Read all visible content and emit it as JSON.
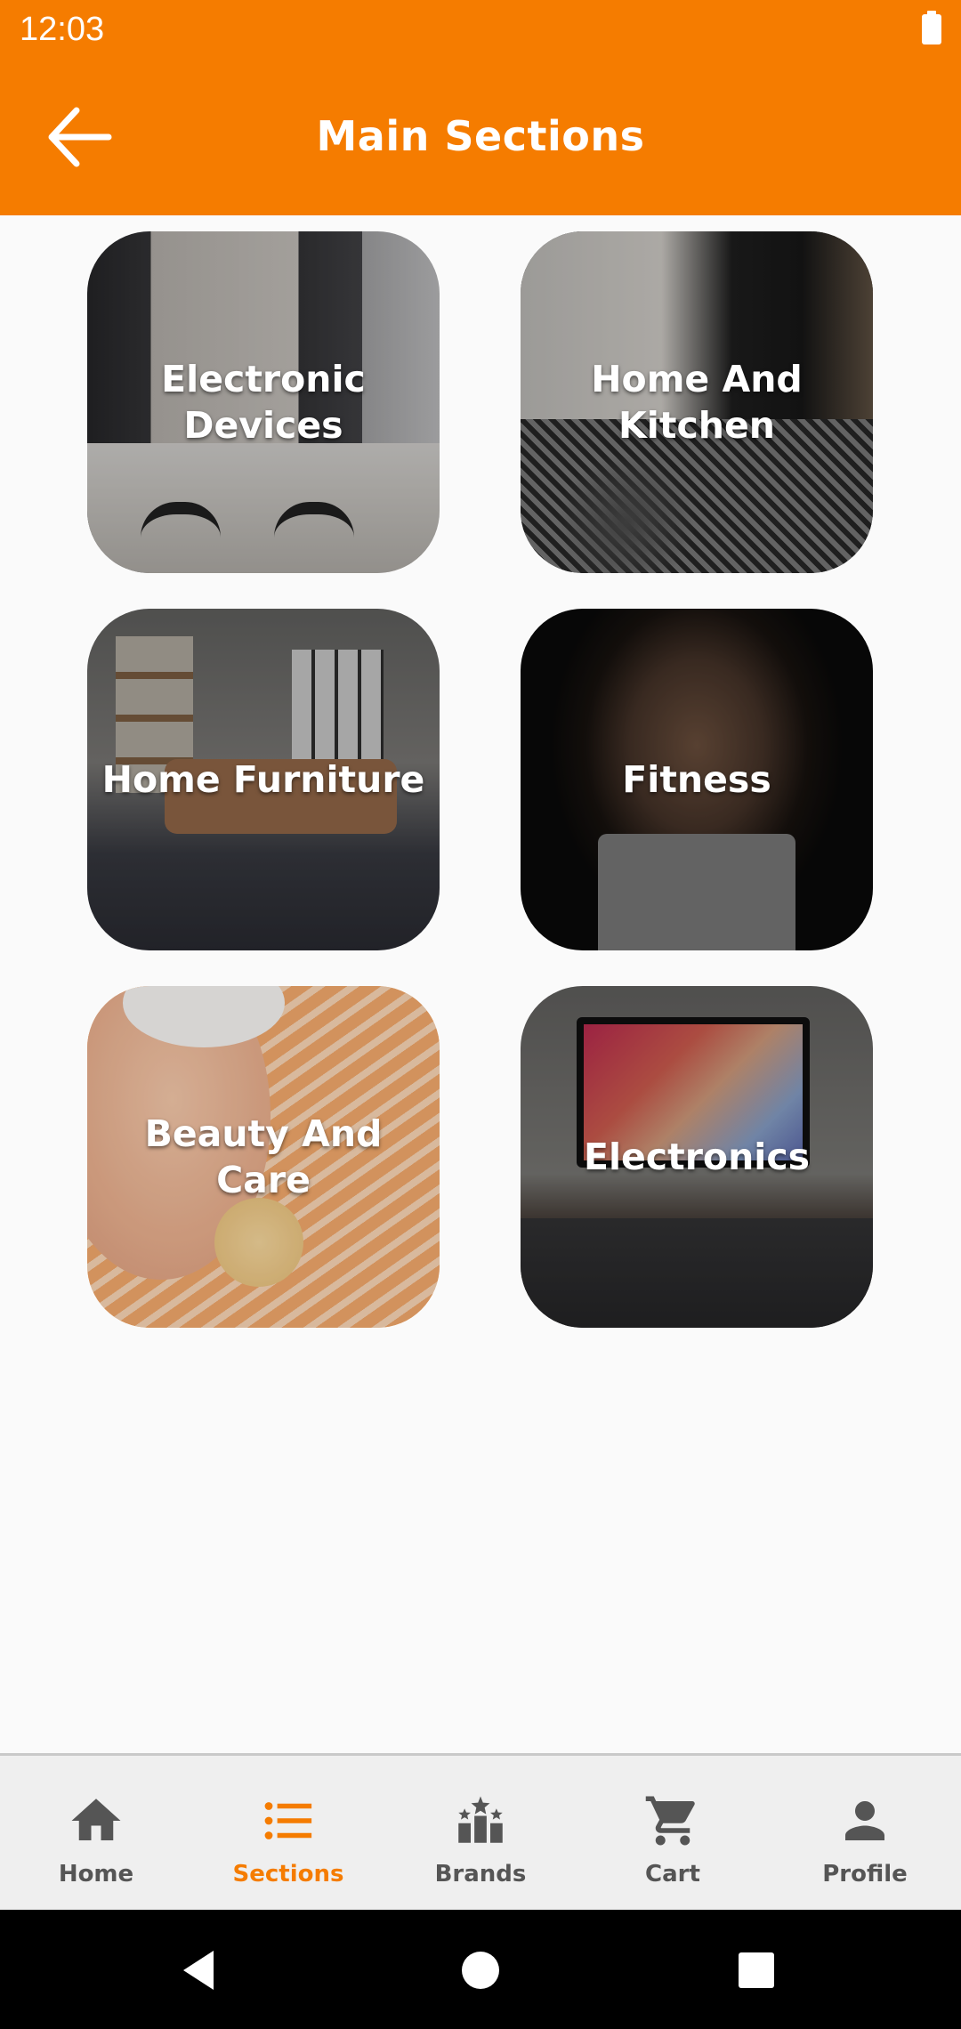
{
  "status_bar": {
    "time": "12:03"
  },
  "app_bar": {
    "title": "Main Sections"
  },
  "sections": [
    {
      "label": "Electronic Devices"
    },
    {
      "label": "Home And Kitchen"
    },
    {
      "label": "Home Furniture"
    },
    {
      "label": "Fitness"
    },
    {
      "label": "Beauty And Care"
    },
    {
      "label": "Electronics"
    }
  ],
  "bottom_nav": {
    "items": [
      {
        "label": "Home",
        "icon": "home-icon"
      },
      {
        "label": "Sections",
        "icon": "list-icon",
        "active": true
      },
      {
        "label": "Brands",
        "icon": "ranking-icon"
      },
      {
        "label": "Cart",
        "icon": "cart-icon"
      },
      {
        "label": "Profile",
        "icon": "person-icon"
      }
    ]
  },
  "colors": {
    "accent": "#f57c00",
    "nav_inactive": "#555555",
    "background": "#fafafa"
  }
}
